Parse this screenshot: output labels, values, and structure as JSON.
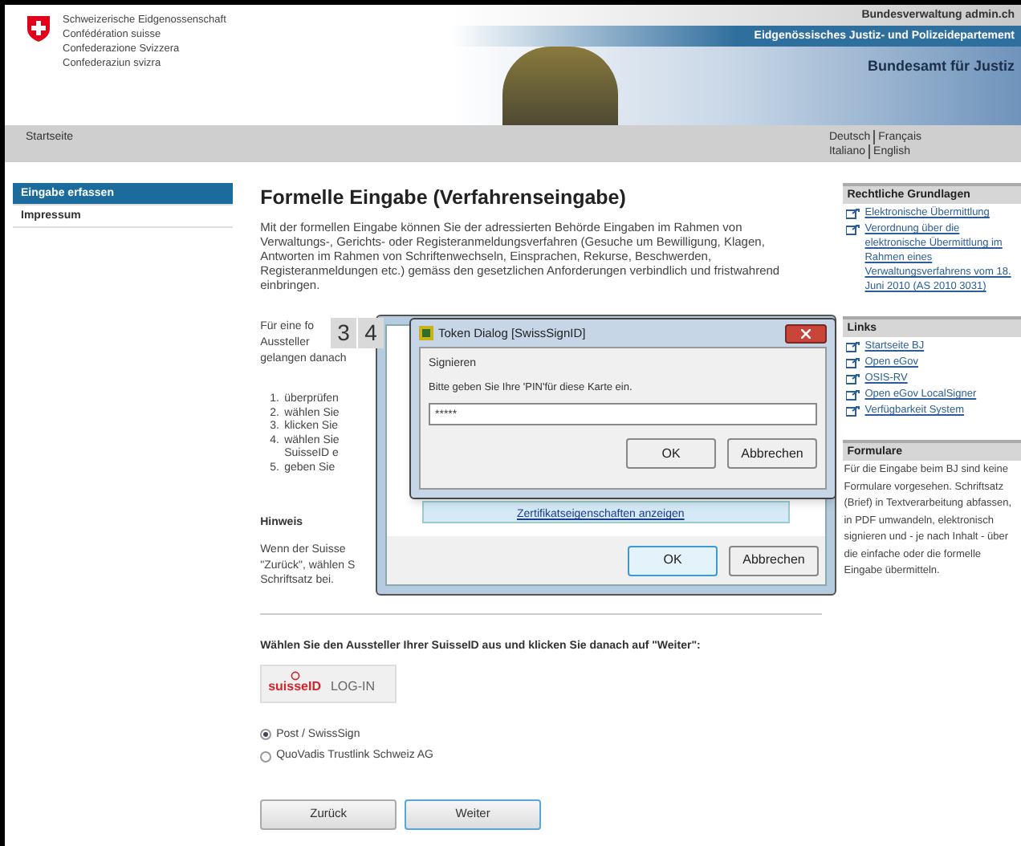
{
  "header": {
    "coat_lines": [
      "Schweizerische Eidgenossenschaft",
      "Confédération suisse",
      "Confederazione Svizzera",
      "Confederaziun svizra"
    ],
    "top_link": "Bundesverwaltung admin.ch",
    "department": "Eidgenössisches Justiz- und Polizeidepartement",
    "office": "Bundesamt für Justiz"
  },
  "nav": {
    "home": "Startseite",
    "language_rows": [
      {
        "items": [
          "Deutsch",
          "Français"
        ]
      },
      {
        "items": [
          "Italiano",
          "English"
        ]
      }
    ]
  },
  "sidebar": {
    "items": [
      {
        "label": "Eingabe erfassen",
        "selected": true
      },
      {
        "label": "Impressum",
        "selected": false
      }
    ]
  },
  "main": {
    "title": "Formelle Eingabe (Verfahrenseingabe)",
    "intro": "Mit der formellen Eingabe können Sie der adressierten Behörde Eingaben im Rahmen von Verwaltungs-, Gerichts- oder Registeranmeldungsverfahren (Gesuche um Bewilligung, Klagen, Antworten im Rahmen von Schriftenwechseln, Einsprachen, Rekurse, Beschwerden, Registeranmeldungen etc.) gemäss den gesetzlichen Anforderungen verbindlich und fristwahrend einbringen.",
    "partial_lines": [
      "Für eine fo",
      "Aussteller",
      "gelangen danach"
    ],
    "steps": [
      {
        "number": "1.",
        "lines": [
          "überprüfen"
        ]
      },
      {
        "number": "2.",
        "lines": [
          "wählen Sie"
        ]
      },
      {
        "number": "3.",
        "lines": [
          "klicken Sie"
        ]
      },
      {
        "number": "4.",
        "lines": [
          "wählen Sie",
          "SuisseID e"
        ]
      },
      {
        "number": "5.",
        "lines": [
          "geben Sie"
        ]
      }
    ],
    "note_heading": "Hinweis",
    "note_lines": [
      "Wenn der Suisse",
      "\"Zurück\", wählen S",
      "Schriftsatz bei."
    ],
    "issuer_prompt": "Wählen Sie den Aussteller Ihrer SuisseID aus und klicken Sie danach auf \"Weiter\":",
    "login_button": {
      "brand": "suisseID",
      "label": "LOG-IN"
    },
    "issuers": [
      {
        "label": "Post / SwissSign",
        "selected": true
      },
      {
        "label": "QuoVadis Trustlink Schweiz AG",
        "selected": false
      }
    ],
    "buttons": [
      {
        "label": "Zurück",
        "focused": false
      },
      {
        "label": "Weiter",
        "focused": true
      }
    ]
  },
  "step_badges": [
    "3",
    "4"
  ],
  "back_dialog": {
    "link": "Zertifikatseigenschaften anzeigen",
    "buttons": [
      {
        "label": "OK",
        "default": true
      },
      {
        "label": "Abbrechen",
        "default": false
      }
    ]
  },
  "token_dialog": {
    "title": "Token Dialog [SwissSignID]",
    "heading": "Signieren",
    "prompt": "Bitte geben Sie Ihre 'PIN'für diese Karte ein.",
    "pin_value": "*****",
    "buttons": [
      {
        "label": "OK",
        "default": false
      },
      {
        "label": "Abbrechen",
        "default": false
      }
    ]
  },
  "right_column": {
    "sections": [
      {
        "heading": "Rechtliche Grundlagen",
        "kind": "links",
        "links": [
          "Elektronische Übermittlung",
          "Verordnung über die elektronische Übermittlung im Rahmen eines Verwaltungsverfahrens vom 18. Juni 2010 (AS 2010 3031)"
        ]
      },
      {
        "heading": "Links",
        "kind": "links",
        "links": [
          "Startseite BJ",
          "Open eGov",
          "OSIS-RV",
          "Open eGov LocalSigner",
          "Verfügbarkeit System"
        ]
      },
      {
        "heading": "Formulare",
        "kind": "text",
        "text": "Für die Eingabe beim BJ sind keine Formulare vorgesehen. Schriftsatz (Brief) in Textverarbeitung abfassen, in PDF umwandeln, elektronisch signieren und - je nach Inhalt - über die einfache oder die formelle Eingabe übermitteln."
      }
    ]
  }
}
